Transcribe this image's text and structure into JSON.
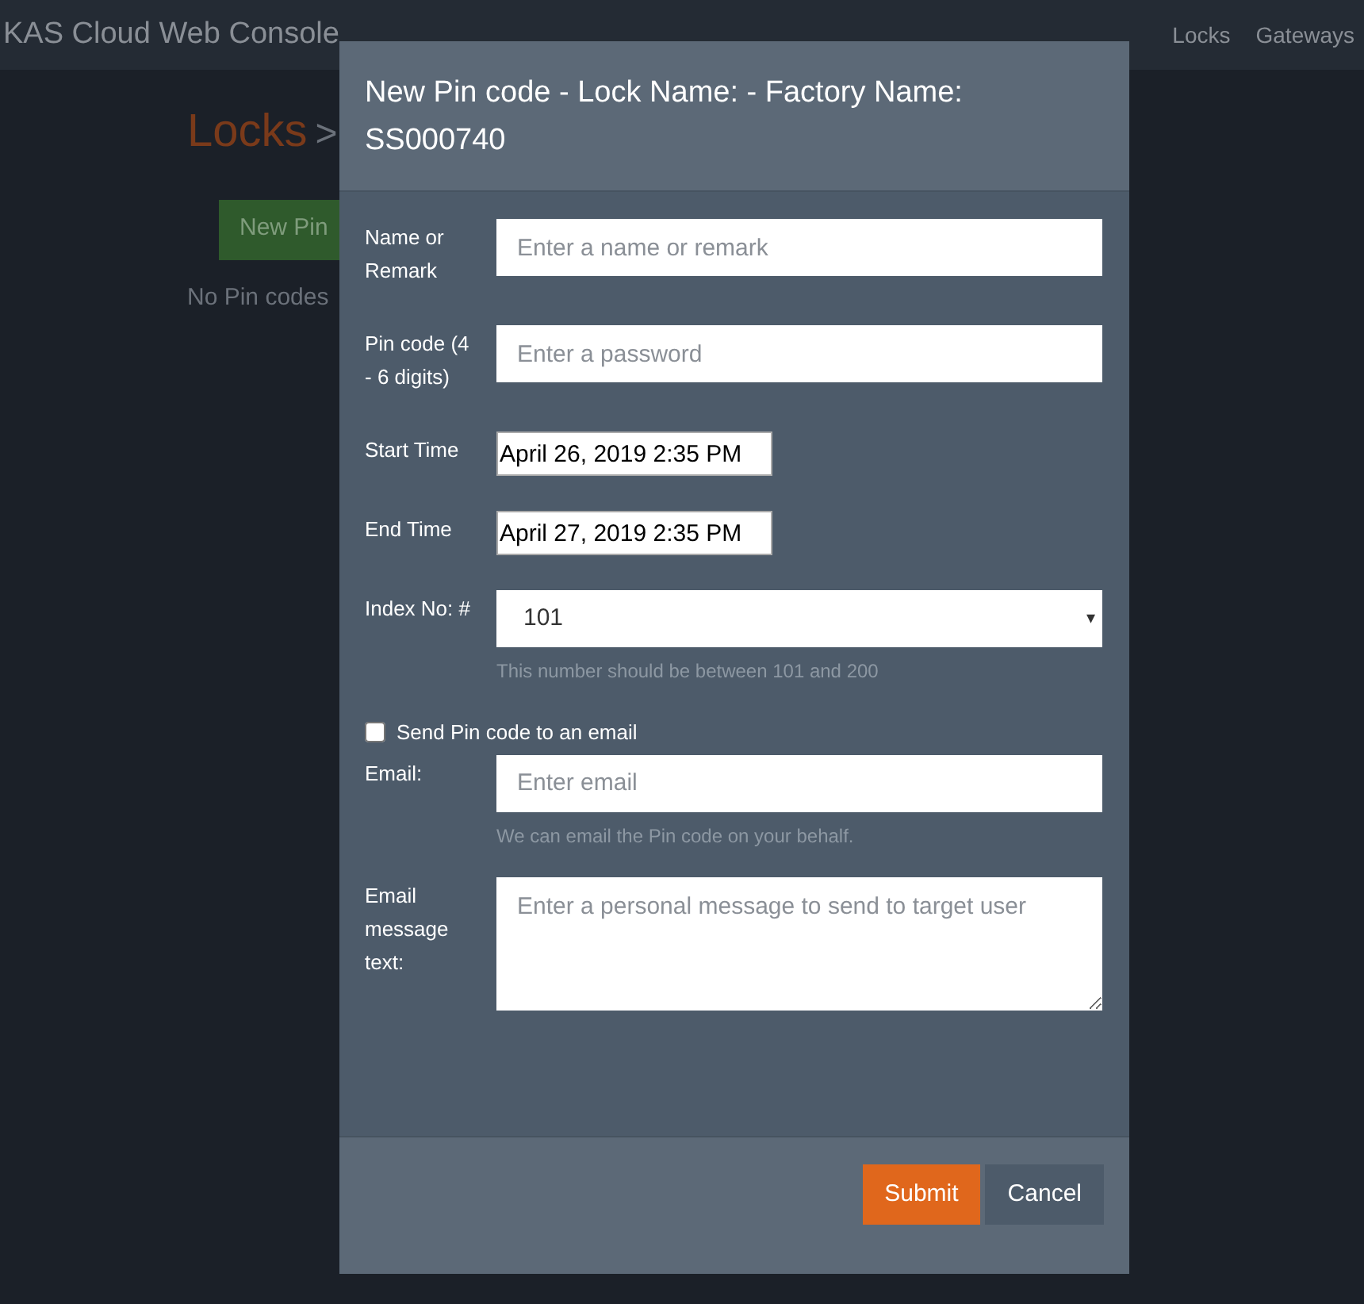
{
  "navbar": {
    "brand": "KAS Cloud Web Console",
    "links": [
      "Locks",
      "Gateways"
    ]
  },
  "page": {
    "breadcrumb": "Locks",
    "separator": ">",
    "new_button": "New Pin",
    "empty_text": "No Pin codes"
  },
  "modal": {
    "title": "New Pin code - Lock Name: - Factory Name: SS000740",
    "fields": [
      {
        "kind": "text",
        "label": "Name or Remark",
        "placeholder": "Enter a name or remark"
      },
      {
        "kind": "text",
        "label": "Pin code (4 - 6 digits)",
        "placeholder": "Enter a password"
      },
      {
        "kind": "date",
        "label": "Start Time",
        "value": "April 26, 2019 2:35 PM"
      },
      {
        "kind": "date",
        "label": "End Time",
        "value": "April 27, 2019 2:35 PM"
      },
      {
        "kind": "select",
        "label": "Index No: #",
        "value": "101",
        "caret": "▾",
        "help": "This number should be between 101 and 200"
      },
      {
        "kind": "checkbox",
        "label": "Send Pin code to an email",
        "checked": false
      },
      {
        "kind": "email",
        "label": "Email:",
        "placeholder": "Enter email",
        "help": "We can email the Pin code on your behalf."
      },
      {
        "kind": "textarea",
        "label": "Email message text:",
        "placeholder": "Enter a personal message to send to target user"
      }
    ],
    "buttons": [
      {
        "kind": "primary",
        "label": "Submit"
      },
      {
        "kind": "secondary",
        "label": "Cancel"
      }
    ]
  }
}
